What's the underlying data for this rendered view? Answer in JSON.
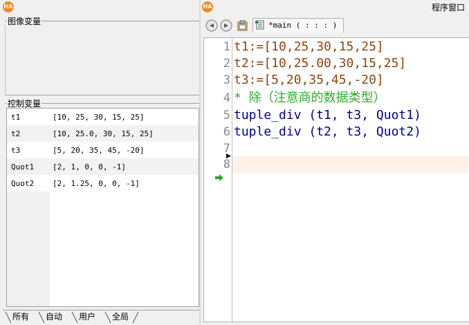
{
  "left_panel": {
    "title": "",
    "image_vars": {
      "label": "图像变量"
    },
    "control_vars": {
      "label": "控制变量",
      "rows": [
        {
          "name": "t1",
          "value": "[10, 25, 30, 15, 25]"
        },
        {
          "name": "t2",
          "value": "[10, 25.0, 30, 15, 25]"
        },
        {
          "name": "t3",
          "value": "[5, 20, 35, 45, -20]"
        },
        {
          "name": "Quot1",
          "value": "[2, 1, 0, 0, -1]"
        },
        {
          "name": "Quot2",
          "value": "[2, 1.25, 0, 0, -1]"
        }
      ]
    },
    "tabs": [
      {
        "label": "所有"
      },
      {
        "label": "自动"
      },
      {
        "label": "用户"
      },
      {
        "label": "全局"
      }
    ]
  },
  "right_panel": {
    "title": "程序窗口",
    "file_tab": "*main ( : : : )",
    "code": [
      {
        "num": "1",
        "text": "t1:=[10,25,30,15,25]",
        "color": "#8b4513"
      },
      {
        "num": "2",
        "text": "t2:=[10,25.00,30,15,25]",
        "color": "#8b4513"
      },
      {
        "num": "3",
        "text": "t3:=[5,20,35,45,-20]",
        "color": "#8b4513"
      },
      {
        "num": "4",
        "text": "* 除（注意商的数据类型）",
        "color": "#2eaa2e"
      },
      {
        "num": "5",
        "text": "tuple_div (t1, t3, Quot1)",
        "color": "#00008b"
      },
      {
        "num": "6",
        "text": "tuple_div (t2, t3, Quot2)",
        "color": "#00008b"
      },
      {
        "num": "7",
        "text": "",
        "color": "#000000"
      },
      {
        "num": "8",
        "text": "",
        "color": "#000000"
      }
    ]
  },
  "icons": {
    "app": "HA",
    "back": "arrow-left-icon",
    "forward": "arrow-right-icon",
    "clipboard": "clipboard-icon",
    "file": "file-icon"
  },
  "colors": {
    "current_line": "#fdf1e8",
    "pc_arrow": "#22aa22",
    "ln_number": "#888888"
  }
}
